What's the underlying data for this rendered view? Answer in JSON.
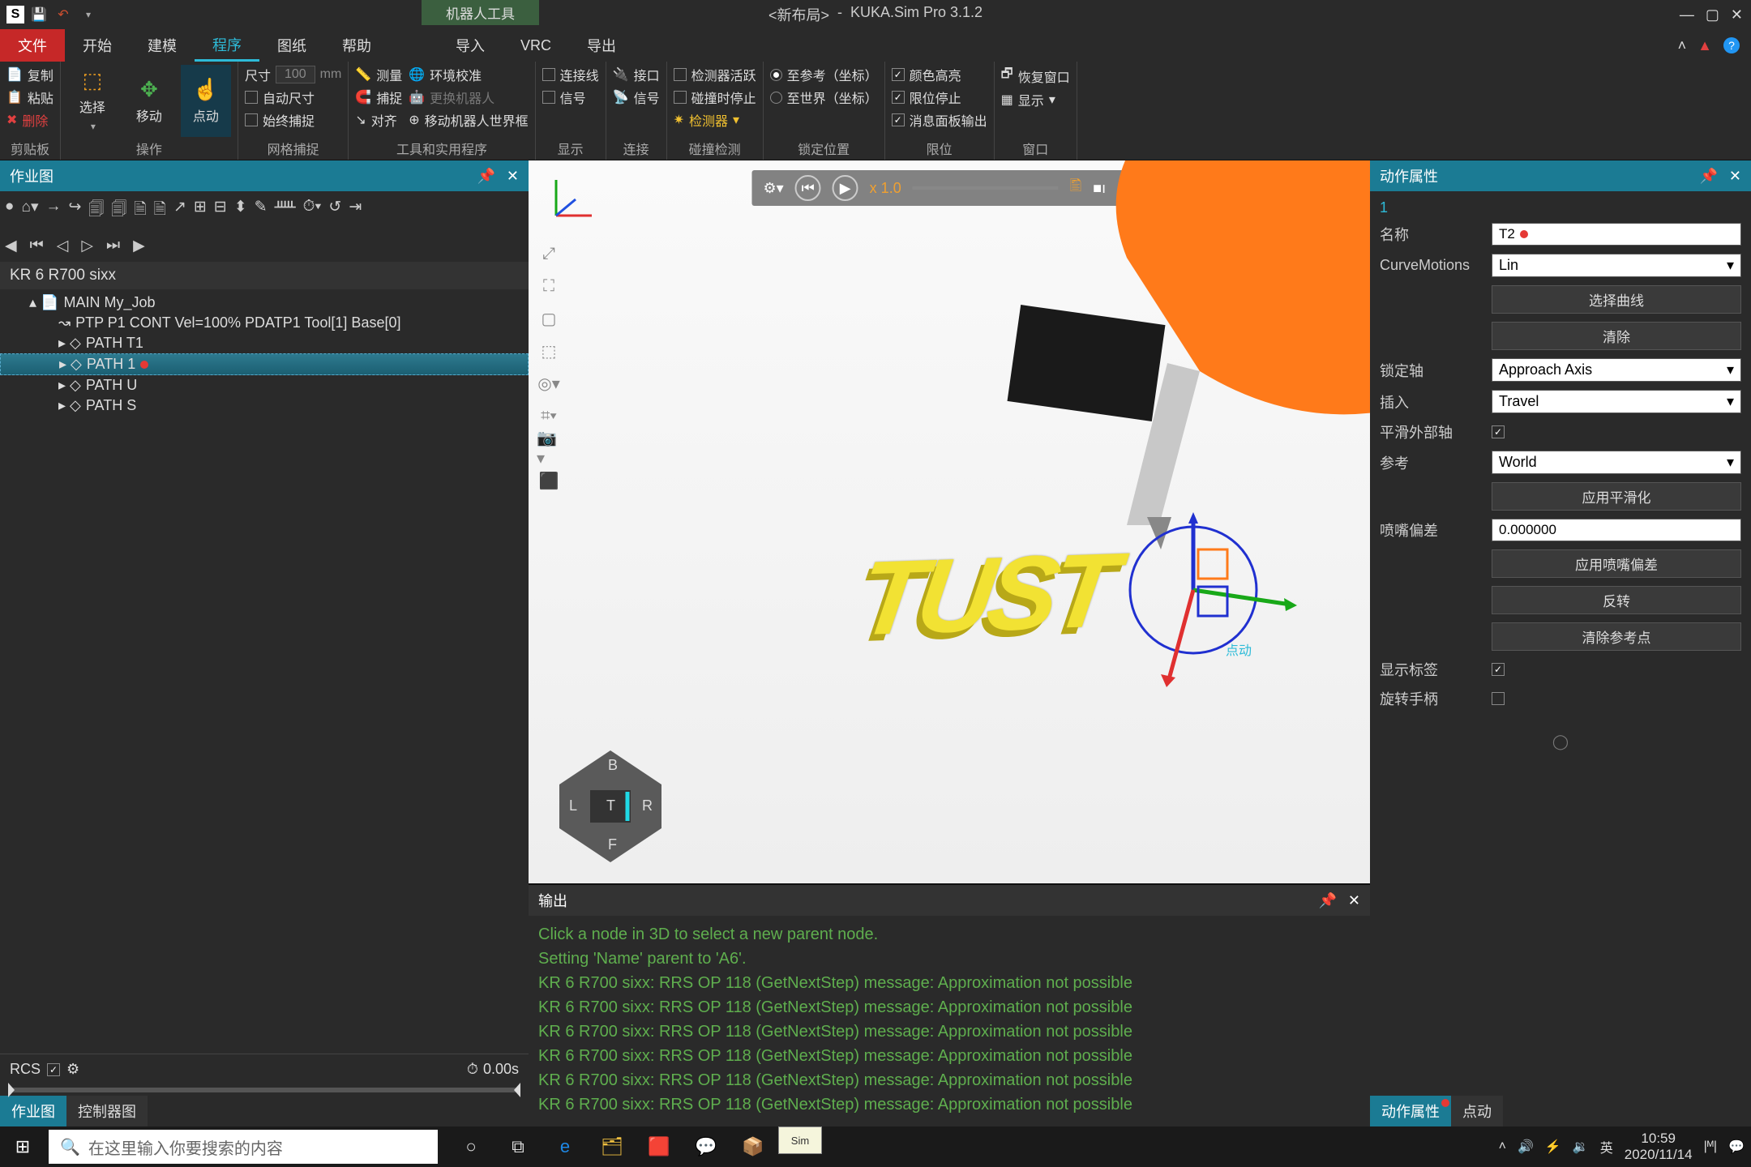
{
  "title": {
    "doc": "<新布局>",
    "sep": " - ",
    "app": "KUKA.Sim Pro 3.1.2"
  },
  "robot_tool": "机器人工具",
  "menu": {
    "file": "文件",
    "tabs": [
      "开始",
      "建模",
      "程序",
      "图纸",
      "帮助"
    ],
    "active": 2,
    "extra": [
      "导入",
      "VRC",
      "导出"
    ]
  },
  "ribbon": {
    "clipboard": {
      "copy": "复制",
      "paste": "粘贴",
      "delete": "删除",
      "label": "剪贴板"
    },
    "ops": {
      "select": "选择",
      "move": "移动",
      "jog": "点动",
      "label": "操作"
    },
    "grid": {
      "size_lbl": "尺寸",
      "size_val": "100",
      "size_unit": "mm",
      "auto": "自动尺寸",
      "always": "始终捕捉",
      "label": "网格捕捉"
    },
    "tools": {
      "measure": "测量",
      "env": "环境校准",
      "snap": "捕捉",
      "swap": "更换机器人",
      "align": "对齐",
      "move_frame": "移动机器人世界框",
      "label": "工具和实用程序"
    },
    "display": {
      "wire": "连接线",
      "signal": "信号",
      "label": "显示"
    },
    "connect": {
      "iface": "接口",
      "sig": "信号",
      "label": "连接"
    },
    "collision": {
      "active": "检测器活跃",
      "stop": "碰撞时停止",
      "detector": "检测器",
      "label": "碰撞检测"
    },
    "lock": {
      "ref": "至参考（坐标）",
      "world": "至世界（坐标）",
      "label": "锁定位置"
    },
    "limits": {
      "color": "颜色高亮",
      "stop": "限位停止",
      "msg": "消息面板输出",
      "label": "限位"
    },
    "window": {
      "restore": "恢复窗口",
      "show": "显示",
      "label": "窗口"
    }
  },
  "left_panel": {
    "title": "作业图",
    "robot": "KR 6 R700 sixx",
    "tree": {
      "main": "MAIN My_Job",
      "ptp": "PTP P1 CONT Vel=100% PDATP1 Tool[1] Base[0]",
      "paths": [
        "PATH T1",
        "PATH 1",
        "PATH U",
        "PATH S"
      ],
      "selected": 1
    },
    "footer": {
      "rcs": "RCS",
      "time": "0.00s"
    },
    "tabs": [
      "作业图",
      "控制器图"
    ]
  },
  "sim": {
    "speed": "x  1.0",
    "jog_label": "点动"
  },
  "nav": {
    "B": "B",
    "L": "L",
    "T": "T",
    "R": "R",
    "F": "F"
  },
  "viewport_text": "TUST",
  "output": {
    "title": "输出",
    "lines": [
      "Click a node in 3D to select a new parent node.",
      "Setting 'Name' parent to 'A6'.",
      "KR 6 R700 sixx: RRS OP 118 (GetNextStep) message: Approximation not possible",
      "KR 6 R700 sixx: RRS OP 118 (GetNextStep) message: Approximation not possible",
      "KR 6 R700 sixx: RRS OP 118 (GetNextStep) message: Approximation not possible",
      "KR 6 R700 sixx: RRS OP 118 (GetNextStep) message: Approximation not possible",
      "KR 6 R700 sixx: RRS OP 118 (GetNextStep) message: Approximation not possible",
      "KR 6 R700 sixx: RRS OP 118 (GetNextStep) message: Approximation not possible"
    ]
  },
  "props": {
    "title": "动作属性",
    "index": "1",
    "name_lbl": "名称",
    "name_val": "T2",
    "curve_lbl": "CurveMotions",
    "curve_val": "Lin",
    "select_curve": "选择曲线",
    "clear": "清除",
    "lock_axis_lbl": "锁定轴",
    "lock_axis_val": "Approach Axis",
    "insert_lbl": "插入",
    "insert_val": "Travel",
    "smooth_ext_lbl": "平滑外部轴",
    "ref_lbl": "参考",
    "ref_val": "World",
    "apply_smooth": "应用平滑化",
    "nozzle_lbl": "喷嘴偏差",
    "nozzle_val": "0.000000",
    "apply_nozzle": "应用喷嘴偏差",
    "reverse": "反转",
    "clear_ref": "清除参考点",
    "show_tag_lbl": "显示标签",
    "rotate_lbl": "旋转手柄",
    "tabs": [
      "动作属性",
      "点动"
    ]
  },
  "taskbar": {
    "search_placeholder": "在这里输入你要搜索的内容",
    "ime": "英",
    "time": "10:59",
    "date": "2020/11/14"
  }
}
